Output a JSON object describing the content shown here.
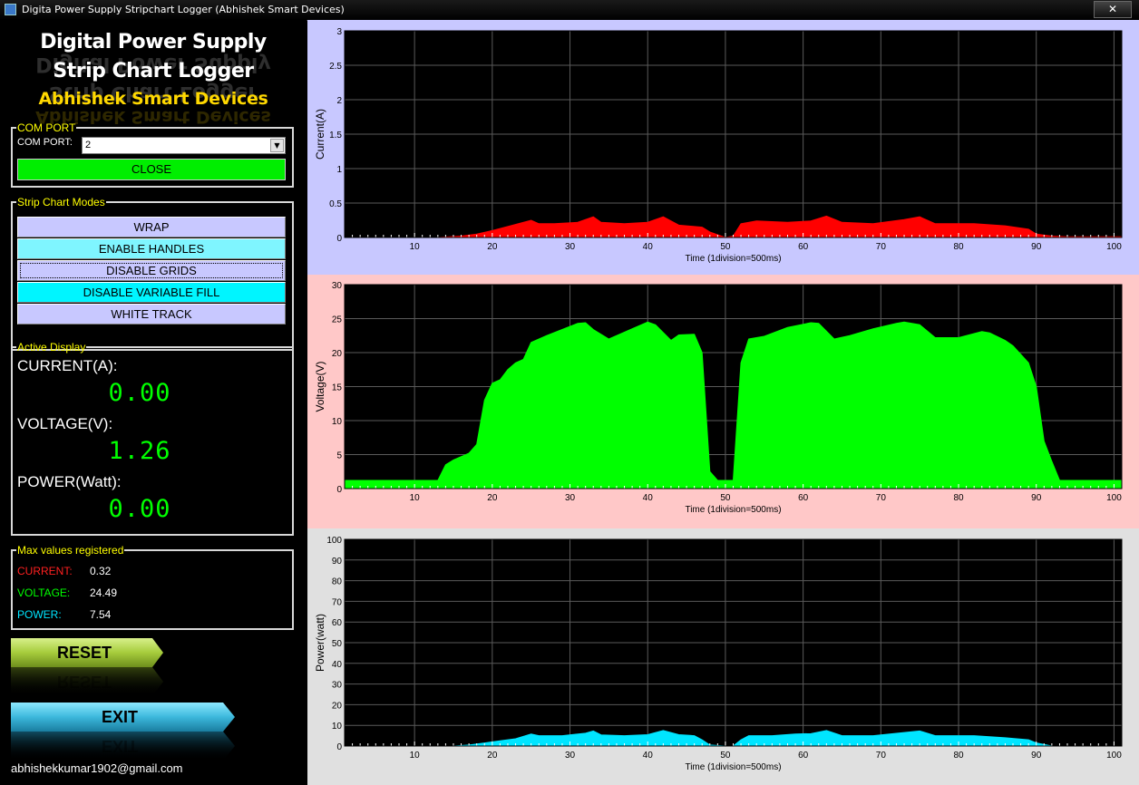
{
  "window": {
    "title": "Digita Power Supply Stripchart Logger (Abhishek Smart Devices)",
    "close_glyph": "✕"
  },
  "logo": {
    "line1": "Digital Power Supply",
    "line2": "Strip Chart Logger",
    "line3": "Abhishek Smart Devices"
  },
  "com_port": {
    "group_label": "COM PORT",
    "field_label": "COM PORT:",
    "selected": "2",
    "button_label": "CLOSE",
    "button_color": "#00ee00"
  },
  "modes": {
    "group_label": "Strip Chart Modes",
    "buttons": [
      {
        "label": "WRAP",
        "color": "#c8c8ff"
      },
      {
        "label": "ENABLE HANDLES",
        "color": "#7ff5ff"
      },
      {
        "label": "DISABLE GRIDS",
        "color": "#c8c8ff"
      },
      {
        "label": "DISABLE VARIABLE FILL",
        "color": "#00f5ff"
      },
      {
        "label": "WHITE TRACK",
        "color": "#c8c8ff"
      }
    ]
  },
  "active_display": {
    "group_label": "Active Display",
    "current_label": "CURRENT(A):",
    "current_value": "0.00",
    "voltage_label": "VOLTAGE(V):",
    "voltage_value": "1.26",
    "power_label": "POWER(Watt):",
    "power_value": "0.00"
  },
  "max_values": {
    "group_label": "Max values registered",
    "current_label": "CURRENT:",
    "current_value": "0.32",
    "current_color": "#ff2020",
    "voltage_label": "VOLTAGE:",
    "voltage_value": "24.49",
    "voltage_color": "#00ff00",
    "power_label": "POWER:",
    "power_value": "7.54",
    "power_color": "#00e5ff"
  },
  "buttons": {
    "reset_label": "RESET",
    "exit_label": "EXIT"
  },
  "email": "abhishekkumar1902@gmail.com",
  "chart_data": [
    {
      "type": "area",
      "ylabel": "Current(A)",
      "xlabel": "Time (1division=500ms)",
      "ylim": [
        0,
        3
      ],
      "xlim": [
        1,
        101
      ],
      "yticks": [
        "0",
        "0.5",
        "1",
        "1.5",
        "2",
        "2.5",
        "3"
      ],
      "xticks": [
        "10",
        "20",
        "30",
        "40",
        "50",
        "60",
        "70",
        "80",
        "90",
        "100"
      ],
      "grid": true,
      "fill_color": "#ff0000",
      "panel_color": "#c8c8ff",
      "x": [
        1,
        13,
        16,
        18,
        20,
        22,
        25,
        26,
        28,
        31,
        33,
        34,
        37,
        40,
        42,
        44,
        47,
        48,
        50,
        51,
        52,
        54,
        58,
        61,
        63,
        65,
        69,
        73,
        75,
        77,
        82,
        86,
        89,
        90,
        92,
        94,
        101
      ],
      "y": [
        0,
        0,
        0.02,
        0.05,
        0.1,
        0.16,
        0.25,
        0.2,
        0.2,
        0.22,
        0.3,
        0.22,
        0.2,
        0.22,
        0.3,
        0.18,
        0.15,
        0.08,
        0,
        0.02,
        0.2,
        0.24,
        0.22,
        0.24,
        0.31,
        0.22,
        0.2,
        0.26,
        0.3,
        0.2,
        0.2,
        0.17,
        0.12,
        0.05,
        0.02,
        0.01,
        0.01
      ]
    },
    {
      "type": "area",
      "ylabel": "Voltage(V)",
      "xlabel": "Time (1division=500ms)",
      "ylim": [
        0,
        30
      ],
      "xlim": [
        1,
        101
      ],
      "yticks": [
        "0",
        "5",
        "10",
        "15",
        "20",
        "25",
        "30"
      ],
      "xticks": [
        "10",
        "20",
        "30",
        "40",
        "50",
        "60",
        "70",
        "80",
        "90",
        "100"
      ],
      "grid": true,
      "fill_color": "#00ff00",
      "panel_color": "#ffc8c8",
      "x": [
        1,
        13,
        14,
        15,
        17,
        18,
        19,
        20,
        21,
        22,
        23,
        24,
        25,
        27,
        29,
        31,
        32,
        33,
        35,
        38,
        40,
        41,
        43,
        44,
        46,
        47,
        48,
        49,
        50,
        51,
        52,
        53,
        55,
        58,
        61,
        62,
        64,
        66,
        69,
        72,
        73,
        75,
        77,
        80,
        83,
        84,
        86,
        87,
        89,
        90,
        91,
        92,
        93,
        101
      ],
      "y": [
        1.2,
        1.2,
        3.5,
        4.2,
        5.2,
        6.5,
        13,
        15.5,
        16,
        17.5,
        18.5,
        19,
        21.5,
        22.5,
        23.4,
        24.3,
        24.4,
        23.4,
        22,
        23.5,
        24.5,
        24.1,
        21.8,
        22.6,
        22.7,
        20,
        2.5,
        1.2,
        1.2,
        1.2,
        18.5,
        22,
        22.4,
        23.7,
        24.4,
        24.3,
        22,
        22.5,
        23.5,
        24.3,
        24.5,
        24.1,
        22.2,
        22.2,
        23.1,
        22.9,
        21.8,
        21,
        18.5,
        15,
        7,
        4,
        1.2,
        1.2
      ]
    },
    {
      "type": "area",
      "ylabel": "Power(watt)",
      "xlabel": "Time (1division=500ms)",
      "ylim": [
        0,
        100
      ],
      "xlim": [
        1,
        101
      ],
      "yticks": [
        "0",
        "10",
        "20",
        "30",
        "40",
        "50",
        "60",
        "70",
        "80",
        "90",
        "100"
      ],
      "xticks": [
        "10",
        "20",
        "30",
        "40",
        "50",
        "60",
        "70",
        "80",
        "90",
        "100"
      ],
      "grid": true,
      "fill_color": "#00e5ff",
      "panel_color": "#e0e0e0",
      "x": [
        1,
        15,
        17,
        19,
        21,
        23,
        25,
        26,
        29,
        32,
        33,
        34,
        37,
        40,
        42,
        44,
        46,
        47,
        48,
        50,
        51,
        52,
        53,
        56,
        59,
        61,
        63,
        65,
        69,
        73,
        75,
        77,
        82,
        86,
        89,
        90,
        92,
        101
      ],
      "y": [
        0,
        0,
        0.5,
        1.5,
        2.5,
        3.5,
        5.8,
        5,
        5,
        6.2,
        7.3,
        5.4,
        5,
        5.5,
        7.5,
        5.5,
        5,
        3,
        0.5,
        0,
        0,
        3,
        5,
        5,
        5.8,
        6,
        7.5,
        5,
        5,
        6.5,
        7.3,
        5,
        5,
        4,
        3,
        1.5,
        0,
        0
      ]
    }
  ]
}
